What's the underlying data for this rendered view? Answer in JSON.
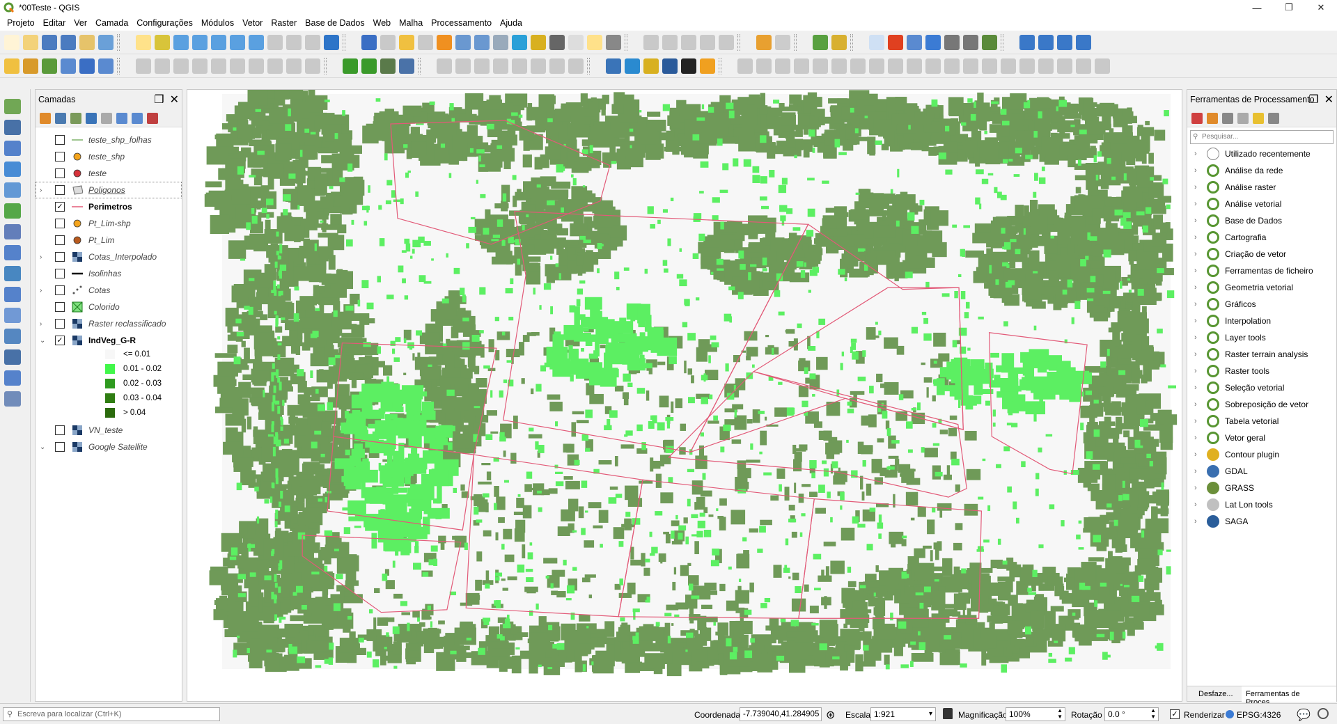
{
  "window": {
    "title": "*00Teste - QGIS",
    "minimize": "—",
    "maximize": "❐",
    "close": "✕"
  },
  "menu": [
    "Projeto",
    "Editar",
    "Ver",
    "Camada",
    "Configurações",
    "Módulos",
    "Vetor",
    "Raster",
    "Base de Dados",
    "Web",
    "Malha",
    "Processamento",
    "Ajuda"
  ],
  "layers_panel": {
    "title": "Camadas",
    "layers": [
      {
        "name": "teste_shp_folhas",
        "checked": false,
        "symbol": "line-green",
        "expandable": false,
        "bold": false
      },
      {
        "name": "teste_shp",
        "checked": false,
        "symbol": "point-orange",
        "expandable": false,
        "bold": false
      },
      {
        "name": "teste",
        "checked": false,
        "symbol": "point-red",
        "expandable": false,
        "bold": false
      },
      {
        "name": "Poligonos",
        "checked": false,
        "symbol": "polygon-icon",
        "expandable": true,
        "bold": false
      },
      {
        "name": "Perimetros",
        "checked": true,
        "symbol": "line-pink",
        "expandable": false,
        "bold": true
      },
      {
        "name": "Pt_Lim-shp",
        "checked": false,
        "symbol": "point-orange",
        "expandable": false,
        "bold": false
      },
      {
        "name": "Pt_Lim",
        "checked": false,
        "symbol": "point-brown",
        "expandable": false,
        "bold": false
      },
      {
        "name": "Cotas_Interpolado",
        "checked": false,
        "symbol": "raster-icon",
        "expandable": true,
        "bold": false
      },
      {
        "name": "Isolinhas",
        "checked": false,
        "symbol": "line-black",
        "expandable": false,
        "bold": false
      },
      {
        "name": "Cotas",
        "checked": false,
        "symbol": "points-icon",
        "expandable": true,
        "bold": false
      },
      {
        "name": "Colorido",
        "checked": false,
        "symbol": "colorido-icon",
        "expandable": false,
        "bold": false
      },
      {
        "name": "Raster reclassificado",
        "checked": false,
        "symbol": "raster-icon",
        "expandable": true,
        "bold": false
      },
      {
        "name": "IndVeg_G-R",
        "checked": true,
        "symbol": "raster-icon",
        "expandable": true,
        "expanded": true,
        "bold": true
      },
      {
        "name": "VN_teste",
        "checked": false,
        "symbol": "raster-icon",
        "expandable": false,
        "bold": false
      },
      {
        "name": "Google Satellite",
        "checked": false,
        "symbol": "raster-icon",
        "expandable": true,
        "expanded": true,
        "bold": false
      }
    ],
    "legend": [
      {
        "label": "<= 0.01",
        "color": "#f7f7f7"
      },
      {
        "label": "0.01 - 0.02",
        "color": "#41f74a"
      },
      {
        "label": "0.02 - 0.03",
        "color": "#2e9a1f"
      },
      {
        "label": "0.03 - 0.04",
        "color": "#2f7d12"
      },
      {
        "label": "> 0.04",
        "color": "#2b6a0d"
      }
    ]
  },
  "processing_panel": {
    "title": "Ferramentas de Processamento",
    "search_placeholder": "Pesquisar...",
    "items": [
      {
        "label": "Utilizado recentemente",
        "icon": "clock-icon"
      },
      {
        "label": "Análise da rede",
        "icon": "qgis-icon"
      },
      {
        "label": "Análise raster",
        "icon": "qgis-icon"
      },
      {
        "label": "Análise vetorial",
        "icon": "qgis-icon"
      },
      {
        "label": "Base de Dados",
        "icon": "qgis-icon"
      },
      {
        "label": "Cartografia",
        "icon": "qgis-icon"
      },
      {
        "label": "Criação de vetor",
        "icon": "qgis-icon"
      },
      {
        "label": "Ferramentas de ficheiro",
        "icon": "qgis-icon"
      },
      {
        "label": "Geometria vetorial",
        "icon": "qgis-icon"
      },
      {
        "label": "Gráficos",
        "icon": "qgis-icon"
      },
      {
        "label": "Interpolation",
        "icon": "qgis-icon"
      },
      {
        "label": "Layer tools",
        "icon": "qgis-icon"
      },
      {
        "label": "Raster terrain analysis",
        "icon": "qgis-icon"
      },
      {
        "label": "Raster tools",
        "icon": "qgis-icon"
      },
      {
        "label": "Seleção vetorial",
        "icon": "qgis-icon"
      },
      {
        "label": "Sobreposição de vetor",
        "icon": "qgis-icon"
      },
      {
        "label": "Tabela vetorial",
        "icon": "qgis-icon"
      },
      {
        "label": "Vetor geral",
        "icon": "qgis-icon"
      },
      {
        "label": "Contour plugin",
        "icon": "contour-icon"
      },
      {
        "label": "GDAL",
        "icon": "gdal-icon"
      },
      {
        "label": "GRASS",
        "icon": "grass-icon"
      },
      {
        "label": "Lat Lon tools",
        "icon": "latlon-icon"
      },
      {
        "label": "SAGA",
        "icon": "saga-icon"
      }
    ],
    "tabs": [
      "Desfaze...",
      "Ferramentas de Proces..."
    ]
  },
  "statusbar": {
    "locator_placeholder": "Escreva para localizar (Ctrl+K)",
    "coord_label": "Coordenada",
    "coord_value": "-7.739040,41.284905",
    "scale_label": "Escala",
    "scale_value": "1:921",
    "magnifier_label": "Magnificação",
    "magnifier_value": "100%",
    "rotation_label": "Rotação",
    "rotation_value": "0.0 °",
    "render_label": "Renderizar",
    "crs": "EPSG:4326"
  },
  "map": {
    "background": "#f7f7f7",
    "dark_green": "#6f9a58",
    "light_green": "#5cef62",
    "perimeter": "#e25a78"
  }
}
